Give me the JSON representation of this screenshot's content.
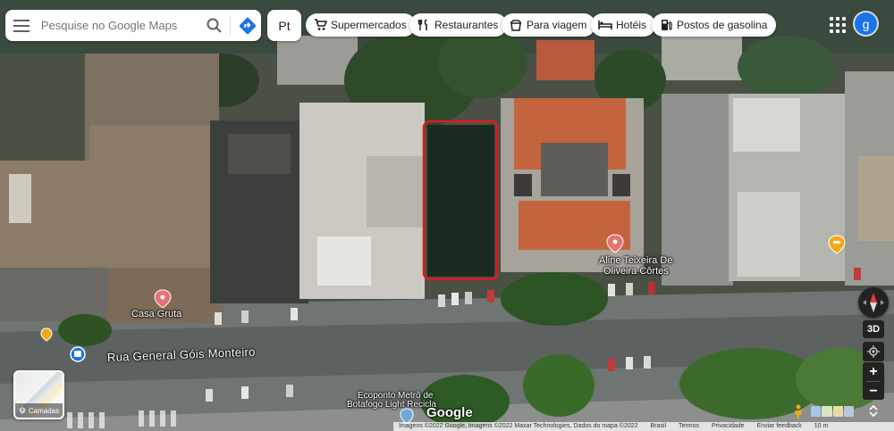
{
  "search": {
    "placeholder": "Pesquise no Google Maps"
  },
  "language": {
    "label": "Pt"
  },
  "chips": [
    {
      "label": "Supermercados",
      "icon": "cart-icon"
    },
    {
      "label": "Restaurantes",
      "icon": "fork-knife-icon"
    },
    {
      "label": "Para viagem",
      "icon": "takeout-icon"
    },
    {
      "label": "Hotéis",
      "icon": "bed-icon"
    },
    {
      "label": "Postos de gasolina",
      "icon": "gas-station-icon"
    }
  ],
  "account": {
    "initial": "g"
  },
  "places": {
    "casa_gruta": "Casa Gruta",
    "aline_line1": "Aline Teixeira De",
    "aline_line2": "Oliveira Côrtes",
    "ecoponto_line1": "Ecoponto Metrô de",
    "ecoponto_line2": "Botafogo Light Recicla"
  },
  "street": {
    "name": "Rua General Góis Monteiro"
  },
  "layers": {
    "label": "Camadas"
  },
  "controls": {
    "three_d": "3D",
    "zoom_in": "+",
    "zoom_out": "−"
  },
  "branding": {
    "logo": "Google"
  },
  "footer": {
    "imagery": "Imagens ©2022 Google, Imagens ©2022 Maxar Technologies, Dados do mapa ©2022",
    "country": "Brasil",
    "terms": "Termos",
    "privacy": "Privacidade",
    "feedback": "Enviar feedback",
    "scale": "10 m"
  },
  "colors": {
    "highlight": "#e0191f",
    "place_pin": "#e57373",
    "hotel_pin": "#f2a918",
    "accent": "#1a73e8"
  }
}
